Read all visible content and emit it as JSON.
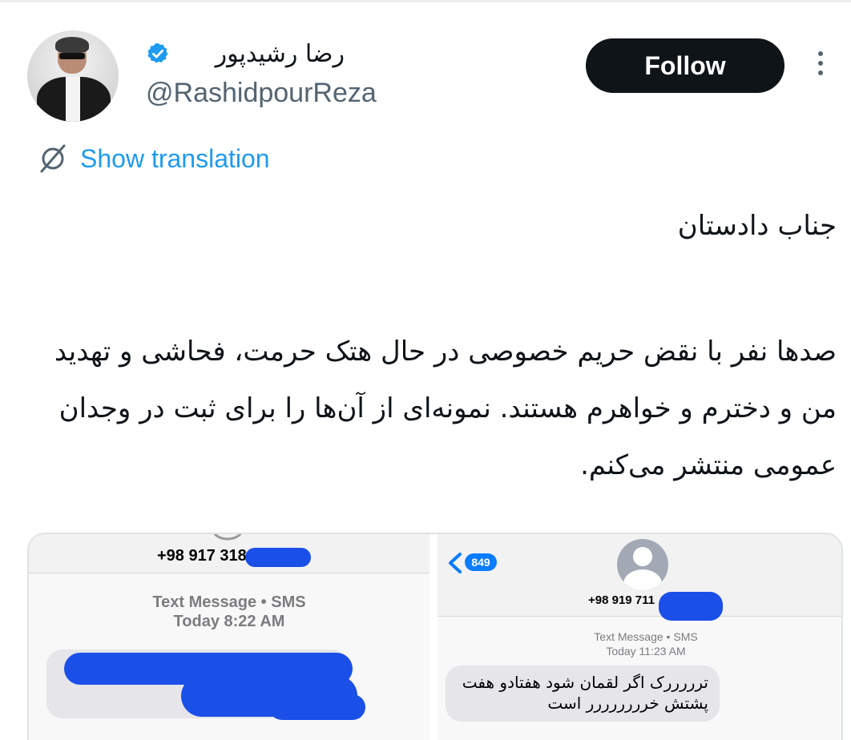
{
  "author": {
    "display_name": "رضا رشیدپور",
    "handle": "@RashidpourReza",
    "verified": true
  },
  "actions": {
    "follow_label": "Follow",
    "show_translation_label": "Show translation"
  },
  "tweet": {
    "line1": "جناب دادستان",
    "paragraph2": "صدها نفر با نقض حریم خصوصی در حال هتک حرمت، فحاشی و تهدید من و دخترم و خواهرم هستند. نمونه‌ای از آن‌ها را برای ثبت در وجدان عمومی منتشر می‌کنم."
  },
  "media": {
    "left": {
      "phone": "+98 917 318",
      "type_label": "Text Message • SMS",
      "time_label": "Today 8:22 AM"
    },
    "right": {
      "badge": "849",
      "phone": "+98 919 711",
      "type_label": "Text Message • SMS",
      "time_label": "Today 11:23 AM",
      "message": "ترررررک اگر لقمان شود هفتادو هفت پشتش خرررررررر است"
    }
  },
  "colors": {
    "accent": "#1d9bf0",
    "follow_bg": "#0f1419",
    "redaction": "#1a4fe8",
    "imessage_blue": "#0a7cff"
  }
}
